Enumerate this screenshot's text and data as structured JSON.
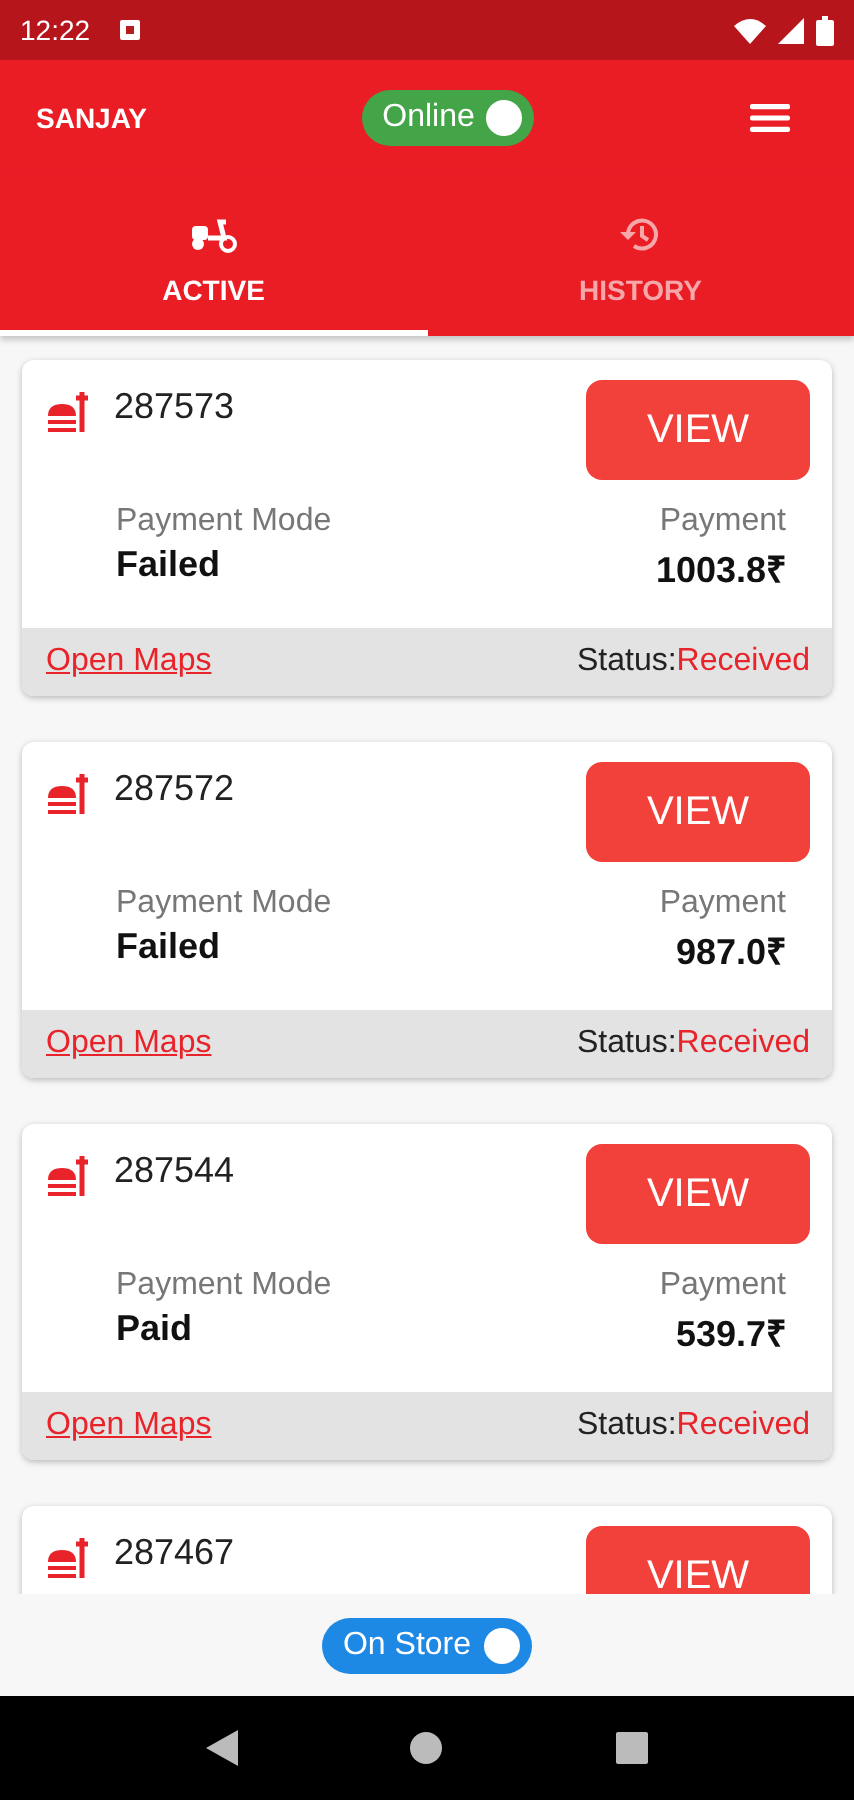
{
  "status_bar": {
    "time": "12:22"
  },
  "header": {
    "title": "SANJAY",
    "online_toggle": {
      "label": "Online",
      "on": true
    }
  },
  "tabs": [
    {
      "label": "ACTIVE",
      "selected": true
    },
    {
      "label": "HISTORY",
      "selected": false
    }
  ],
  "orders": [
    {
      "order_no": "287573",
      "view_label": "VIEW",
      "mode_label": "Payment Mode",
      "mode": "Failed",
      "payment_label": "Payment",
      "amount": "1003.8₹",
      "maps_link": "Open Maps",
      "status_label": "Status:",
      "status": "Received"
    },
    {
      "order_no": "287572",
      "view_label": "VIEW",
      "mode_label": "Payment Mode",
      "mode": "Failed",
      "payment_label": "Payment",
      "amount": "987.0₹",
      "maps_link": "Open Maps",
      "status_label": "Status:",
      "status": "Received"
    },
    {
      "order_no": "287544",
      "view_label": "VIEW",
      "mode_label": "Payment Mode",
      "mode": "Paid",
      "payment_label": "Payment",
      "amount": "539.7₹",
      "maps_link": "Open Maps",
      "status_label": "Status:",
      "status": "Received"
    },
    {
      "order_no": "287467",
      "view_label": "VIEW"
    }
  ],
  "store_toggle": {
    "label": "On Store",
    "on": true
  }
}
